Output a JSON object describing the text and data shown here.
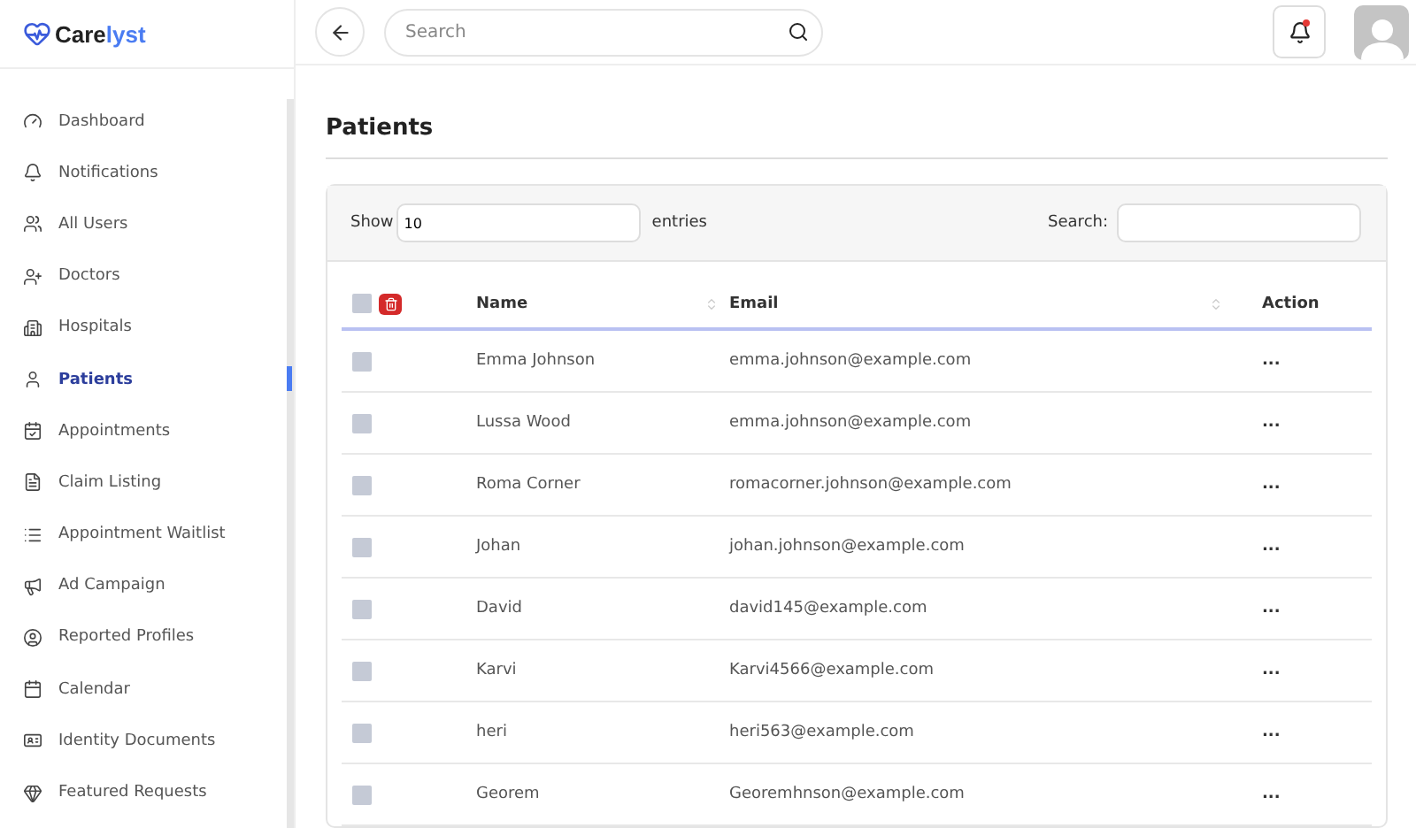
{
  "logo": {
    "part_1": "Care",
    "part_2": "lyst"
  },
  "sidebar": {
    "items": [
      {
        "label": "Dashboard",
        "selected": false
      },
      {
        "label": "Notifications",
        "selected": false
      },
      {
        "label": "All Users",
        "selected": false
      },
      {
        "label": "Doctors",
        "selected": false
      },
      {
        "label": "Hospitals",
        "selected": false
      },
      {
        "label": "Patients",
        "selected": true
      },
      {
        "label": "Appointments",
        "selected": false
      },
      {
        "label": "Claim Listing",
        "selected": false
      },
      {
        "label": "Appointment Waitlist",
        "selected": false
      },
      {
        "label": "Ad Campaign",
        "selected": false
      },
      {
        "label": "Reported Profiles",
        "selected": false
      },
      {
        "label": "Calendar",
        "selected": false
      },
      {
        "label": "Identity Documents",
        "selected": false
      },
      {
        "label": "Featured Requests",
        "selected": false
      }
    ]
  },
  "header": {
    "search": {
      "placeholder": "Search"
    },
    "notifications_unread": true
  },
  "page_title": "Patients",
  "table_controls": {
    "show_label": "Show",
    "page_size": "10",
    "entries_label": "entries",
    "search_label": "Search:"
  },
  "table": {
    "select_all_checked": false,
    "columns": [
      "Name",
      "Email",
      "Action"
    ],
    "rows": [
      {
        "checked": false,
        "name": "Emma Johnson",
        "email": "emma.johnson@example.com",
        "action": "..."
      },
      {
        "checked": false,
        "name": "Lussa Wood",
        "email": "emma.johnson@example.com",
        "action": "..."
      },
      {
        "checked": false,
        "name": "Roma Corner",
        "email": "romacorner.johnson@example.com",
        "action": "..."
      },
      {
        "checked": false,
        "name": "Johan",
        "email": "johan.johnson@example.com",
        "action": "..."
      },
      {
        "checked": false,
        "name": "David",
        "email": "david145@example.com",
        "action": "..."
      },
      {
        "checked": false,
        "name": "Karvi",
        "email": "Karvi4566@example.com",
        "action": "..."
      },
      {
        "checked": false,
        "name": "heri",
        "email": "heri563@example.com",
        "action": "..."
      },
      {
        "checked": false,
        "name": "Georem",
        "email": "Georemhnson@example.com",
        "action": "..."
      }
    ]
  }
}
